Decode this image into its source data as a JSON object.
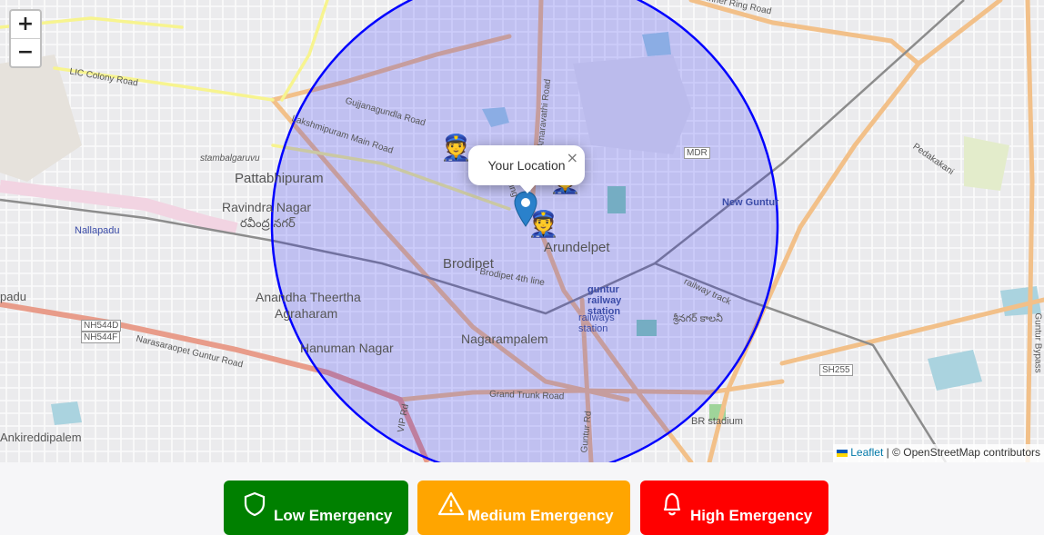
{
  "map": {
    "zoom_in": "+",
    "zoom_out": "−",
    "popup": {
      "text": "Your Location",
      "close": "×"
    },
    "attribution": {
      "link": "Leaflet",
      "separator": " | © ",
      "text": "OpenStreetMap contributors"
    },
    "circle_color": "#0000ff",
    "circle_fill": "rgba(0,0,255,0.18)",
    "places": {
      "pattabhipuram": "Pattabhipuram",
      "ravindra_nagar": "Ravindra Nagar",
      "ravindra_nagar_te": "రవీంద్ర నగర్",
      "nallapadu": "Nallapadu",
      "brodipet": "Brodipet",
      "arundelpet": "Arundelpet",
      "anandha": "Anandha Theertha",
      "agraharam": "Agraharam",
      "hanuman_nagar": "Hanuman Nagar",
      "nagarampalem": "Nagarampalem",
      "new_guntur": "New Guntur",
      "stambalgaruvu": "stambalgaruvu",
      "ankireddipalem": "Ankireddipalem",
      "padu": "padu",
      "guntur_railway": "guntur railway station",
      "railways_station": "railways station",
      "br_stadium": "BR stadium",
      "telugu_right": "శ్రీనగర్ కాలనీ",
      "pedakakani": "Pedakakani"
    },
    "roads": {
      "inner_ring": "Inner Ring Road",
      "lic_colony": "LIC Colony Road",
      "gujjanagundla": "Gujjanagundla Road",
      "lakshmipuram": "Lakshmipuram Main Road",
      "amaravathi": "Amaravathi Road",
      "ring_road": "Ring Road",
      "brodipet_4th": "Brodipet 4th line",
      "railway_track": "railway track",
      "grand_trunk": "Grand Trunk Road",
      "narasaraopet": "Narasaraopet Guntur Road",
      "vip_rd": "VIP Rd",
      "guntur_bypass": "Guntur Bypass",
      "mdr": "MDR",
      "sh255": "SH255",
      "nh544d": "NH544D",
      "nh544f": "NH544F",
      "guntur_rd": "Guntur Rd"
    }
  },
  "buttons": {
    "low": {
      "label": "Low Emergency",
      "color": "#008000"
    },
    "medium": {
      "label": "Medium Emergency",
      "color": "#ffa500"
    },
    "high": {
      "label": "High Emergency",
      "color": "#ff0000"
    }
  }
}
